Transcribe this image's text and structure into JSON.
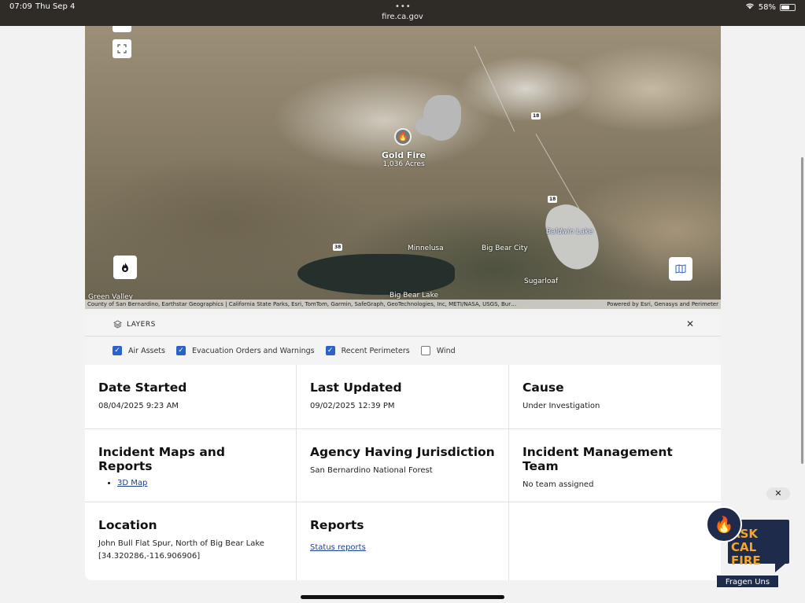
{
  "status_bar": {
    "time": "07:09",
    "date": "Thu Sep 4",
    "url": "fire.ca.gov",
    "battery": "58%"
  },
  "map": {
    "fire_name": "Gold Fire",
    "fire_acres": "1,036 Acres",
    "places": [
      "Minnelusa",
      "Big Bear City",
      "Baldwin Lake",
      "Sugarloaf",
      "Big Bear Lake",
      "Green Valley"
    ],
    "highways": [
      "18",
      "18",
      "38"
    ],
    "attribution_left": "County of San Bernardino, Earthstar Geographics | California State Parks, Esri, TomTom, Garmin, SafeGraph, GeoTechnologies, Inc, METI/NASA, USGS, Bur…",
    "attribution_right": "Powered by Esri, Genasys and Perimeter"
  },
  "layers": {
    "title": "LAYERS",
    "options": [
      {
        "label": "Air Assets",
        "checked": true
      },
      {
        "label": "Evacuation Orders and Warnings",
        "checked": true
      },
      {
        "label": "Recent Perimeters",
        "checked": true
      },
      {
        "label": "Wind",
        "checked": false
      }
    ]
  },
  "info": {
    "date_started": {
      "title": "Date Started",
      "value": "08/04/2025 9:23 AM"
    },
    "last_updated": {
      "title": "Last Updated",
      "value": "09/02/2025 12:39 PM"
    },
    "cause": {
      "title": "Cause",
      "value": "Under Investigation"
    },
    "maps_reports": {
      "title": "Incident Maps and Reports",
      "link": "3D Map"
    },
    "agency": {
      "title": "Agency Having Jurisdiction",
      "value": "San Bernardino National Forest"
    },
    "team": {
      "title": "Incident Management Team",
      "value": "No team assigned"
    },
    "location": {
      "title": "Location",
      "value": "John Bull Flat Spur, North of Big Bear Lake",
      "coords": "[34.320286,-116.906906]"
    },
    "reports": {
      "title": "Reports",
      "link": "Status reports"
    }
  },
  "ask_widget": {
    "line1": "ASK",
    "line2": "CAL FIRE",
    "cta": "Fragen Uns",
    "close": "✕"
  }
}
